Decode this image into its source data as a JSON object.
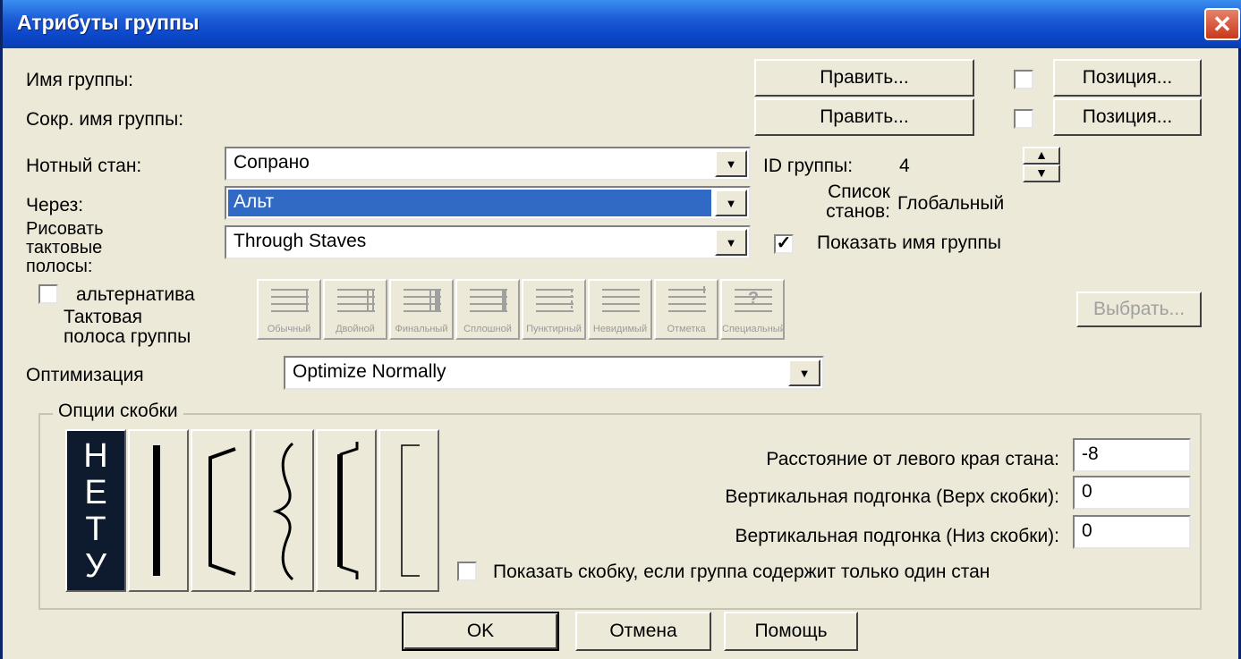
{
  "window": {
    "title": "Атрибуты группы",
    "close_symbol": "✕"
  },
  "group_name": {
    "label": "Имя группы:",
    "edit_label": "Править...",
    "position_label": "Позиция...",
    "checked": false
  },
  "short_group_name": {
    "label": "Сокр. имя группы:",
    "edit_label": "Править...",
    "position_label": "Позиция...",
    "checked": false
  },
  "staff": {
    "label": "Нотный стан:",
    "value": "Сопрано"
  },
  "through": {
    "label": "Через:",
    "value": "Альт"
  },
  "barlines": {
    "label_lines": [
      "Рисовать",
      "тактовые",
      "полосы:"
    ],
    "value": "Through Staves"
  },
  "group_id": {
    "label": "ID группы:",
    "value": "4",
    "spin_up": "▲",
    "spin_down": "▼"
  },
  "staff_list": {
    "label_lines": [
      "Список",
      "станов:"
    ],
    "value": "Глобальный"
  },
  "show_group_name": {
    "label": "Показать имя группы",
    "checked": true,
    "check_mark": "✓"
  },
  "alternative": {
    "label": "альтернатива",
    "checked": false,
    "group_barline_lines": [
      "Тактовая",
      "полоса группы"
    ]
  },
  "barline_styles": [
    {
      "caption": "Обычный",
      "icon": "barline-normal-icon"
    },
    {
      "caption": "Двойной",
      "icon": "barline-double-icon"
    },
    {
      "caption": "Финальный",
      "icon": "barline-final-icon"
    },
    {
      "caption": "Сплошной",
      "icon": "barline-solid-icon"
    },
    {
      "caption": "Пунктирный",
      "icon": "barline-dashed-icon"
    },
    {
      "caption": "Невидимый",
      "icon": "barline-invisible-icon"
    },
    {
      "caption": "Отметка",
      "icon": "barline-tick-icon"
    },
    {
      "caption": "Специальный",
      "icon": "barline-custom-icon"
    }
  ],
  "choose_label": "Выбрать...",
  "optimization": {
    "label": "Оптимизация",
    "value": "Optimize Normally"
  },
  "bracket_options": {
    "legend": "Опции скобки",
    "none_letters": [
      "Н",
      "Е",
      "Т",
      "У"
    ],
    "selected": "none",
    "distance_label": "Расстояние от левого края стана:",
    "distance_value": "-8",
    "top_label": "Вертикальная подгонка (Верх скобки):",
    "top_value": "0",
    "bottom_label": "Вертикальная подгонка (Низ скобки):",
    "bottom_value": "0",
    "show_single_label": "Показать скобку, если группа содержит только один стан",
    "show_single_checked": false
  },
  "footer": {
    "ok_label": "OK",
    "cancel_label": "Отмена",
    "help_label": "Помощь"
  },
  "colors": {
    "titlebar": "#0A46C8",
    "dialog_bg": "#ECE9D8",
    "selection": "#316AC5",
    "bracket_selected_bg": "#0E1A2E"
  }
}
